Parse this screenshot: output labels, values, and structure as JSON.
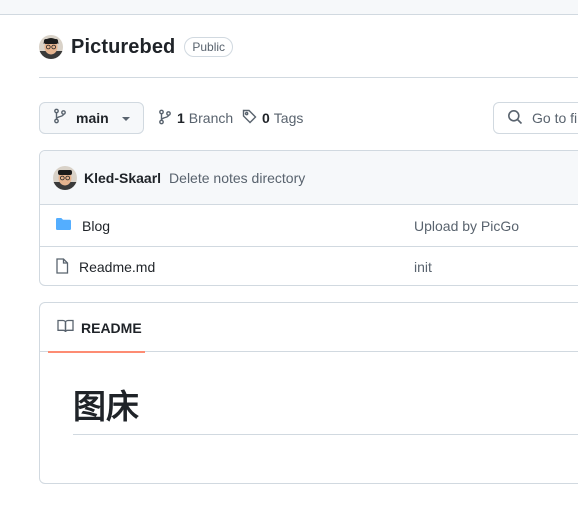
{
  "repo": {
    "name": "Picturebed",
    "visibility": "Public"
  },
  "toolbar": {
    "branch": "main",
    "branches_count": "1",
    "branches_label": "Branch",
    "tags_count": "0",
    "tags_label": "Tags",
    "goto_placeholder": "Go to file"
  },
  "latest_commit": {
    "author": "Kled-Skaarl",
    "message": "Delete notes directory"
  },
  "files": [
    {
      "name": "Blog",
      "type": "folder",
      "commit": "Upload by PicGo"
    },
    {
      "name": "Readme.md",
      "type": "file",
      "commit": "init"
    }
  ],
  "readme": {
    "tab_label": "README",
    "heading": "图床"
  },
  "colors": {
    "folder": "#54aeff",
    "tab_underline": "#fd8c73",
    "border": "#d1d9e0"
  }
}
